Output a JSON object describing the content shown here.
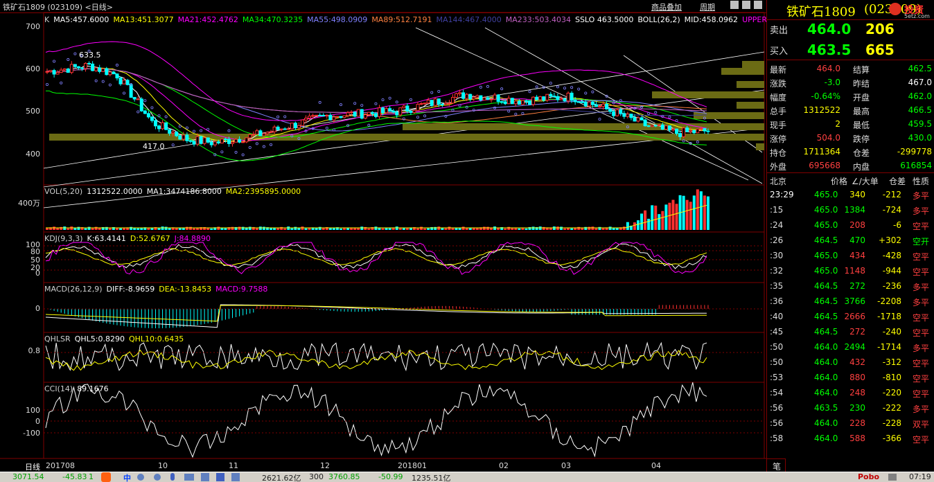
{
  "header": {
    "title": "铁矿石1809 (023109)  <日线>",
    "btn_overlay": "商品叠加",
    "btn_period": "周期"
  },
  "main_chart": {
    "indicators": [
      {
        "text": "K",
        "color": "#d0d0d0"
      },
      {
        "text": "MA5:457.6000",
        "color": "#ffffff"
      },
      {
        "text": "MA13:451.3077",
        "color": "#ffff00"
      },
      {
        "text": "MA21:452.4762",
        "color": "#ff00ff"
      },
      {
        "text": "MA34:470.3235",
        "color": "#00ff00"
      },
      {
        "text": "MA55:498.0909",
        "color": "#8080ff"
      },
      {
        "text": "MA89:512.7191",
        "color": "#ff8040"
      },
      {
        "text": "MA144:467.4000",
        "color": "#4040a0"
      },
      {
        "text": "MA233:503.4034",
        "color": "#c060c0"
      },
      {
        "text": "SSLO 463.5000",
        "color": "#ffffff"
      },
      {
        "text": "BOLL(26,2)",
        "color": "#ffffff"
      },
      {
        "text": "MID:458.0962",
        "color": "#ffffff"
      },
      {
        "text": "UPPER",
        "color": "#ff00ff"
      }
    ],
    "y_ticks": [
      "700",
      "600",
      "500",
      "400"
    ],
    "annotation_high": "633.5",
    "annotation_low": "417.0",
    "x_ticks": [
      "日线",
      "201708",
      "10",
      "11",
      "12",
      "201801",
      "02",
      "03",
      "04"
    ]
  },
  "vol_panel": {
    "indicators": [
      {
        "text": "VOL(5,20)",
        "color": "#d0d0d0"
      },
      {
        "text": "1312522.0000",
        "color": "#ffffff"
      },
      {
        "text": "MA1:3474186.8000",
        "color": "#ffffff"
      },
      {
        "text": "MA2:2395895.0000",
        "color": "#ffff00"
      }
    ],
    "y_tick": "400万"
  },
  "kdj_panel": {
    "indicators": [
      {
        "text": "KDJ(9,3,3)",
        "color": "#d0d0d0"
      },
      {
        "text": "K:63.4141",
        "color": "#ffffff"
      },
      {
        "text": "D:52.6767",
        "color": "#ffff00"
      },
      {
        "text": "J:84.8890",
        "color": "#ff00ff"
      }
    ],
    "y_ticks": [
      "100",
      "80",
      "50",
      "20",
      "0"
    ]
  },
  "macd_panel": {
    "indicators": [
      {
        "text": "MACD(26,12,9)",
        "color": "#d0d0d0"
      },
      {
        "text": "DIFF:-8.9659",
        "color": "#ffffff"
      },
      {
        "text": "DEA:-13.8453",
        "color": "#ffff00"
      },
      {
        "text": "MACD:9.7588",
        "color": "#ff00ff"
      }
    ],
    "y_tick": "0"
  },
  "qhlsr_panel": {
    "indicators": [
      {
        "text": "QHLSR",
        "color": "#d0d0d0"
      },
      {
        "text": "QHL5:0.8290",
        "color": "#ffffff"
      },
      {
        "text": "QHL10:0.6435",
        "color": "#ffff00"
      }
    ],
    "y_tick": "0.8"
  },
  "cci_panel": {
    "indicators": [
      {
        "text": "CCI(14)",
        "color": "#d0d0d0"
      },
      {
        "text": "89.1676",
        "color": "#ffffff"
      }
    ],
    "y_ticks": [
      "100",
      "0",
      "-100"
    ]
  },
  "quote": {
    "name": "铁矿石1809",
    "code": "(023109)",
    "logo": "5etz.com",
    "logo_text": "投资",
    "sell_label": "卖出",
    "sell_price": "464.0",
    "sell_vol": "206",
    "buy_label": "买入",
    "buy_price": "463.5",
    "buy_vol": "665",
    "rows": [
      {
        "l1": "最新",
        "v1": "464.0",
        "c1": "#ff4040",
        "l2": "结算",
        "v2": "462.5",
        "c2": "#00ff00"
      },
      {
        "l1": "涨跌",
        "v1": "-3.0",
        "c1": "#00ff00",
        "l2": "昨结",
        "v2": "467.0",
        "c2": "#ffffff"
      },
      {
        "l1": "幅度",
        "v1": "-0.64%",
        "c1": "#00ff00",
        "l2": "开盘",
        "v2": "462.0",
        "c2": "#00ff00"
      },
      {
        "l1": "总手",
        "v1": "1312522",
        "c1": "#ffff00",
        "l2": "最高",
        "v2": "466.5",
        "c2": "#00ff00"
      },
      {
        "l1": "现手",
        "v1": "2",
        "c1": "#ffff00",
        "l2": "最低",
        "v2": "459.5",
        "c2": "#00ff00"
      },
      {
        "l1": "涨停",
        "v1": "504.0",
        "c1": "#ff4040",
        "l2": "跌停",
        "v2": "430.0",
        "c2": "#00ff00"
      },
      {
        "l1": "持仓",
        "v1": "1711364",
        "c1": "#ffff00",
        "l2": "仓差",
        "v2": "-299778",
        "c2": "#ffff00"
      },
      {
        "l1": "外盘",
        "v1": "695668",
        "c1": "#ff4040",
        "l2": "内盘",
        "v2": "616854",
        "c2": "#00ff00"
      }
    ]
  },
  "ticks": {
    "headers": {
      "time": "北京",
      "price": "价格",
      "vol": "∠/大单",
      "diff": "仓差",
      "type": "性质"
    },
    "rows": [
      {
        "t": "23:29",
        "p": "465.0",
        "v": "340",
        "vc": "#ffff00",
        "d": "-212",
        "tp": "多平",
        "tc": "#ff4040"
      },
      {
        "t": ":15",
        "p": "465.0",
        "v": "1384",
        "vc": "#00ff00",
        "d": "-724",
        "tp": "多平",
        "tc": "#ff4040"
      },
      {
        "t": ":24",
        "p": "465.0",
        "v": "208",
        "vc": "#ff4040",
        "d": "-6",
        "tp": "空平",
        "tc": "#ff4040"
      },
      {
        "t": ":26",
        "p": "464.5",
        "v": "470",
        "vc": "#00ff00",
        "d": "+302",
        "tp": "空开",
        "tc": "#00ff00"
      },
      {
        "t": ":30",
        "p": "465.0",
        "v": "434",
        "vc": "#ff4040",
        "d": "-428",
        "tp": "空平",
        "tc": "#ff4040"
      },
      {
        "t": ":32",
        "p": "465.0",
        "v": "1148",
        "vc": "#ff4040",
        "d": "-944",
        "tp": "空平",
        "tc": "#ff4040"
      },
      {
        "t": ":35",
        "p": "464.5",
        "v": "272",
        "vc": "#00ff00",
        "d": "-236",
        "tp": "多平",
        "tc": "#ff4040"
      },
      {
        "t": ":36",
        "p": "464.5",
        "v": "3766",
        "vc": "#00ff00",
        "d": "-2208",
        "tp": "多平",
        "tc": "#ff4040"
      },
      {
        "t": ":40",
        "p": "464.5",
        "v": "2666",
        "vc": "#ff4040",
        "d": "-1718",
        "tp": "空平",
        "tc": "#ff4040"
      },
      {
        "t": ":45",
        "p": "464.5",
        "v": "272",
        "vc": "#ff4040",
        "d": "-240",
        "tp": "空平",
        "tc": "#ff4040"
      },
      {
        "t": ":50",
        "p": "464.0",
        "v": "2494",
        "vc": "#00ff00",
        "d": "-1714",
        "tp": "多平",
        "tc": "#ff4040"
      },
      {
        "t": ":50",
        "p": "464.0",
        "v": "432",
        "vc": "#ff4040",
        "d": "-312",
        "tp": "空平",
        "tc": "#ff4040"
      },
      {
        "t": ":53",
        "p": "464.0",
        "v": "880",
        "vc": "#ff4040",
        "d": "-810",
        "tp": "空平",
        "tc": "#ff4040"
      },
      {
        "t": ":54",
        "p": "464.0",
        "v": "248",
        "vc": "#ff4040",
        "d": "-220",
        "tp": "空平",
        "tc": "#ff4040"
      },
      {
        "t": ":56",
        "p": "463.5",
        "v": "230",
        "vc": "#00ff00",
        "d": "-222",
        "tp": "多平",
        "tc": "#ff4040"
      },
      {
        "t": ":56",
        "p": "464.0",
        "v": "228",
        "vc": "#ff4040",
        "d": "-228",
        "tp": "双平",
        "tc": "#ff4040"
      },
      {
        "t": ":58",
        "p": "464.0",
        "v": "588",
        "vc": "#ff4040",
        "d": "-366",
        "tp": "空平",
        "tc": "#ff4040"
      }
    ],
    "footer_label": "笔"
  },
  "taskbar": {
    "v1": "3071.54",
    "v2": "-45.83",
    "v3": "1",
    "v4": "2621.62亿",
    "v5": "300",
    "v6": "3760.85",
    "v7": "-50.99",
    "v8": "1235.51亿",
    "ime": "中",
    "brand": "Pobo",
    "time": "07:19"
  },
  "colors": {
    "up": "#ff3030",
    "down": "#00ffff",
    "grid": "#800000"
  }
}
